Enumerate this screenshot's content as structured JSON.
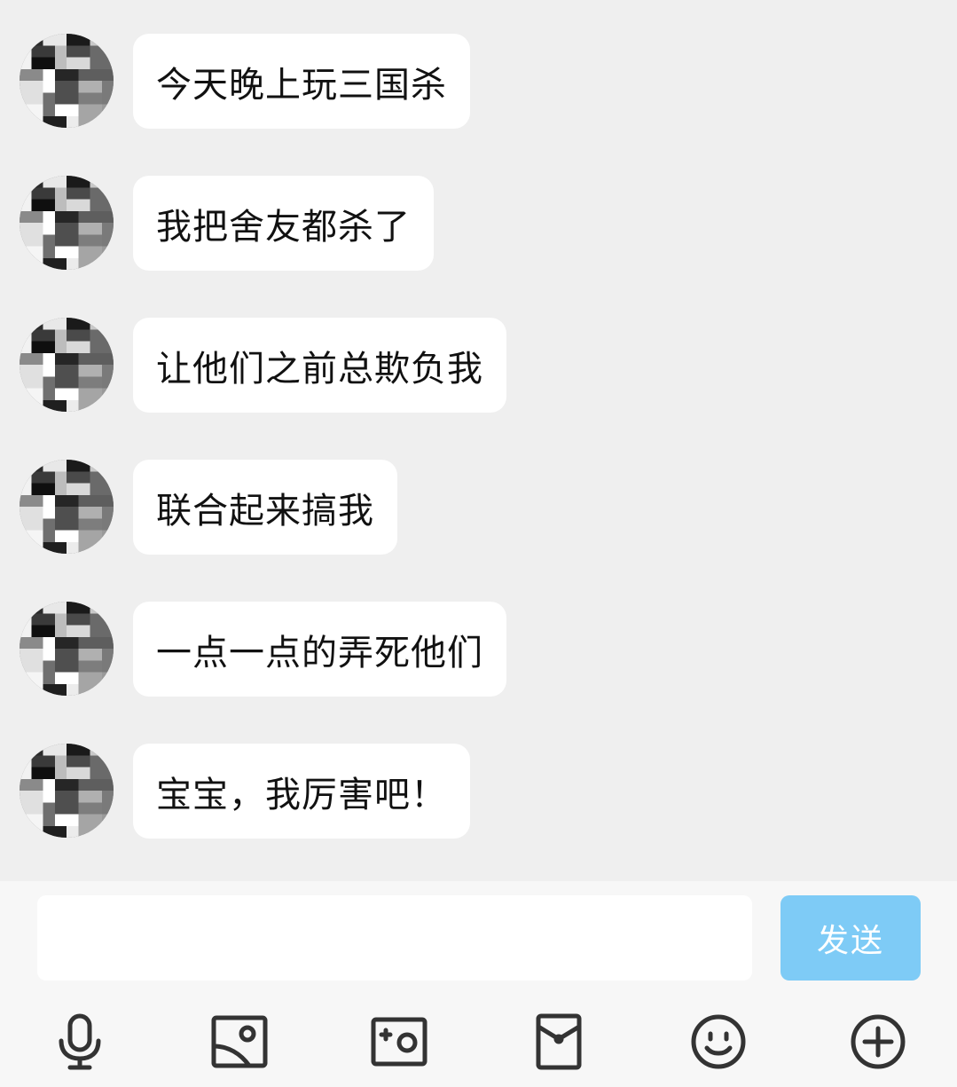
{
  "messages": [
    {
      "text": "今天晚上玩三国杀"
    },
    {
      "text": "我把舍友都杀了"
    },
    {
      "text": "让他们之前总欺负我"
    },
    {
      "text": "联合起来搞我"
    },
    {
      "text": "一点一点的弄死他们"
    },
    {
      "text": "宝宝，我厉害吧！"
    }
  ],
  "composer": {
    "input_value": "",
    "send_label": "发送"
  },
  "toolbar": {
    "icons": [
      "microphone-icon",
      "image-icon",
      "camera-icon",
      "red-packet-icon",
      "emoji-icon",
      "plus-icon"
    ]
  },
  "colors": {
    "background": "#efefef",
    "bubble": "#ffffff",
    "send_button": "#7ecbf6",
    "icon": "#333333"
  }
}
